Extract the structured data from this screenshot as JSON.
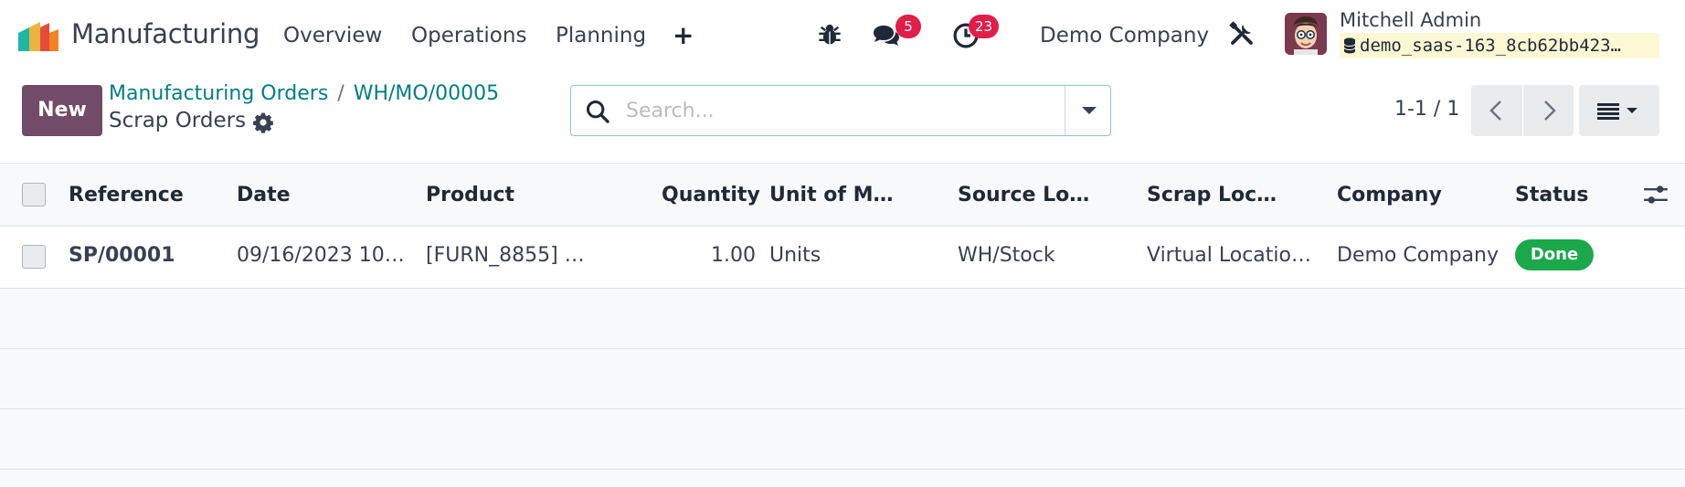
{
  "navbar": {
    "app_name": "Manufacturing",
    "menus": [
      "Overview",
      "Operations",
      "Planning"
    ],
    "plus_label": "+",
    "chat_badge": "5",
    "activity_badge": "23",
    "company": "Demo Company",
    "user_name": "Mitchell Admin",
    "database": "demo_saas-163_8cb62bb423…"
  },
  "control_panel": {
    "new_label": "New",
    "breadcrumb": [
      "Manufacturing Orders",
      "WH/MO/00005"
    ],
    "breadcrumb_separator": "/",
    "title": "Scrap Orders",
    "search_placeholder": "Search...",
    "pager": "1-1 / 1"
  },
  "table": {
    "columns": [
      "Reference",
      "Date",
      "Product",
      "Quantity",
      "Unit of M…",
      "Source Lo…",
      "Scrap Loc…",
      "Company",
      "Status"
    ],
    "rows": [
      {
        "reference": "SP/00001",
        "date": "09/16/2023 10…",
        "product": "[FURN_8855] …",
        "quantity": "1.00",
        "uom": "Units",
        "source_location": "WH/Stock",
        "scrap_location": "Virtual Locatio…",
        "company": "Demo Company",
        "status": "Done"
      }
    ]
  },
  "colors": {
    "brand": "#714b67",
    "link": "#017e84",
    "badge": "#e11d48",
    "status_done": "#1ba84a"
  },
  "icons": [
    "bug-icon",
    "chat-icon",
    "clock-icon",
    "tools-icon",
    "database-icon",
    "gear-icon",
    "search-icon",
    "chevron-left-icon",
    "chevron-right-icon",
    "list-view-icon",
    "column-options-icon"
  ]
}
